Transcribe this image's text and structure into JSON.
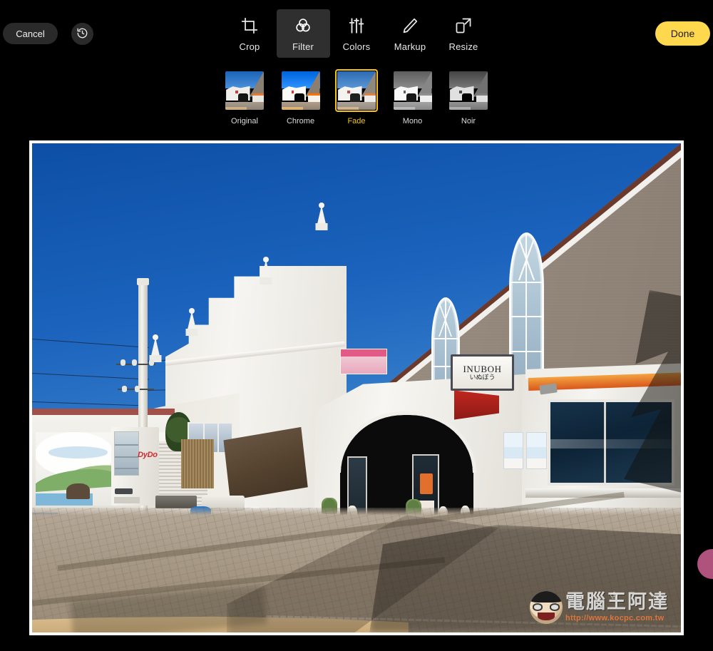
{
  "app": {
    "theme_background": "#000000",
    "accent": "#ffd84d",
    "selection": "#f5c518"
  },
  "toolbar": {
    "cancel_label": "Cancel",
    "done_label": "Done",
    "revert_icon": "revert-clock-icon",
    "tools": [
      {
        "id": "crop",
        "label": "Crop",
        "icon": "crop-icon",
        "active": false
      },
      {
        "id": "filter",
        "label": "Filter",
        "icon": "filter-icon",
        "active": true
      },
      {
        "id": "colors",
        "label": "Colors",
        "icon": "sliders-icon",
        "active": false
      },
      {
        "id": "markup",
        "label": "Markup",
        "icon": "pencil-icon",
        "active": false
      },
      {
        "id": "resize",
        "label": "Resize",
        "icon": "resize-icon",
        "active": false
      }
    ]
  },
  "filters": {
    "selected": "Fade",
    "items": [
      {
        "label": "Original",
        "style": "original",
        "selected": false
      },
      {
        "label": "Chrome",
        "style": "chrome",
        "selected": false
      },
      {
        "label": "Fade",
        "style": "fade",
        "selected": true
      },
      {
        "label": "Mono",
        "style": "mono",
        "selected": false
      },
      {
        "label": "Noir",
        "style": "noir",
        "selected": false
      }
    ]
  },
  "photo": {
    "alt": "Street photo of a white and brown seaside shop building under a deep blue sky",
    "signs": {
      "shop_name_en": "INUBOH",
      "shop_name_jp": "いぬぼう",
      "vending_brand": "DyDo"
    },
    "watermark": {
      "site_name": "電腦王阿達",
      "url": "http://www.kocpc.com.tw",
      "crown_icon": "crown-icon",
      "face_icon": "mascot-face-icon"
    }
  }
}
